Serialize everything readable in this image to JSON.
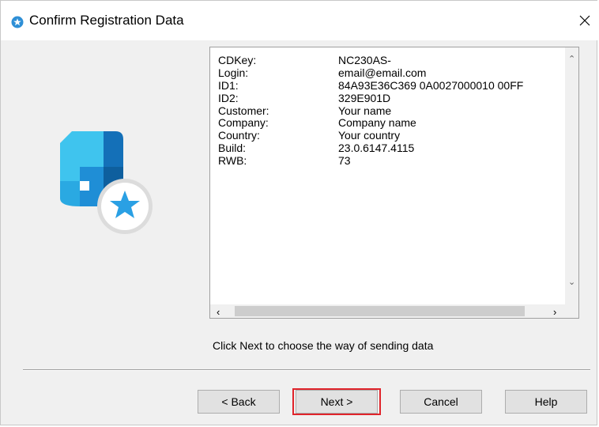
{
  "window": {
    "title": "Confirm Registration Data"
  },
  "registration_rows": [
    {
      "key": "CDKey:",
      "value": "NC230AS-"
    },
    {
      "key": "Login:",
      "value": "email@email.com"
    },
    {
      "key": "ID1:",
      "value": "84A93E36C369 0A0027000010 00FF"
    },
    {
      "key": "ID2:",
      "value": "329E901D"
    },
    {
      "key": "Customer:",
      "value": "Your name"
    },
    {
      "key": "Company:",
      "value": "Company name"
    },
    {
      "key": "Country:",
      "value": "Your country"
    },
    {
      "key": "Build:",
      "value": "23.0.6147.4115"
    },
    {
      "key": "RWB:",
      "value": "73"
    }
  ],
  "hint": "Click Next to choose the way of sending data",
  "buttons": {
    "back": "< Back",
    "next": "Next >",
    "cancel": "Cancel",
    "help": "Help"
  },
  "icons": {
    "app": "star-badge-icon",
    "close": "close-icon",
    "art": "app-logo-star-icon"
  },
  "colors": {
    "accent": "#2e8fd6",
    "highlight": "#e0242b"
  }
}
